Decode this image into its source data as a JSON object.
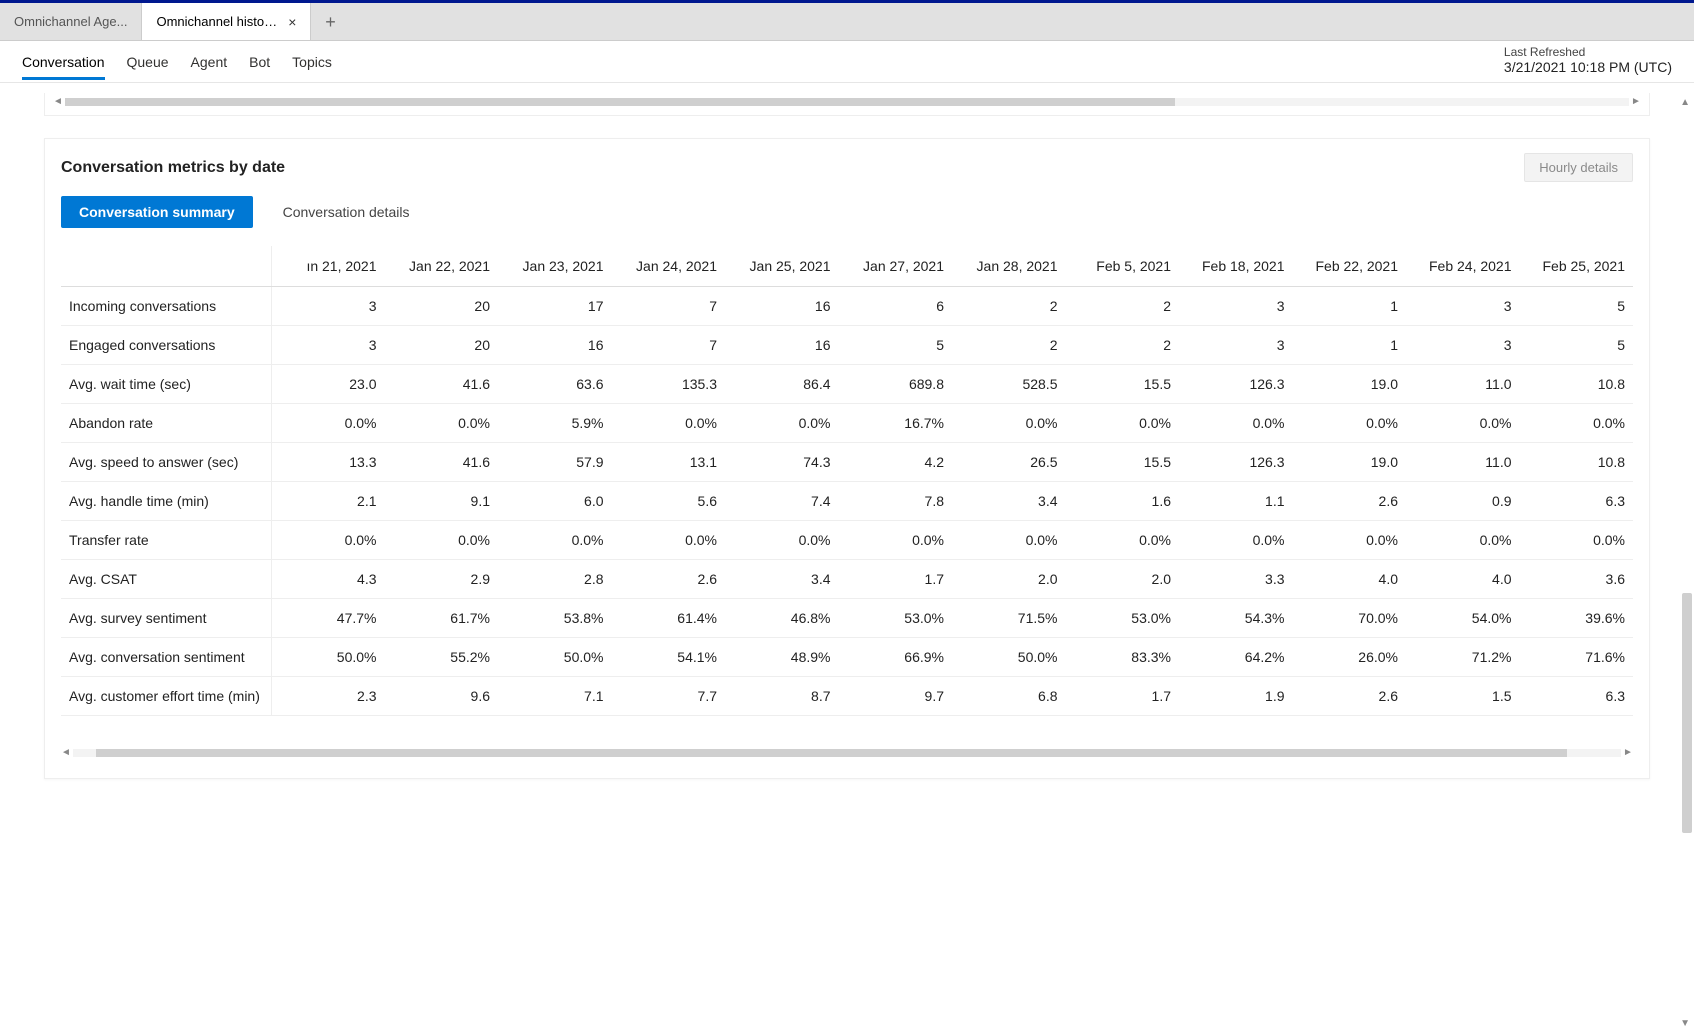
{
  "tabs": {
    "items": [
      {
        "label": "Omnichannel Age..."
      },
      {
        "label": "Omnichannel historical an..."
      }
    ],
    "activeIndex": 1
  },
  "nav": {
    "items": [
      "Conversation",
      "Queue",
      "Agent",
      "Bot",
      "Topics"
    ],
    "activeIndex": 0
  },
  "refresh": {
    "label": "Last Refreshed",
    "value": "3/21/2021 10:18 PM (UTC)"
  },
  "card": {
    "title": "Conversation metrics by date",
    "hourly_label": "Hourly details",
    "pills": [
      "Conversation summary",
      "Conversation details"
    ],
    "pillActive": 0
  },
  "chart_data": {
    "type": "table",
    "columns": [
      "ın 21, 2021",
      "Jan 22, 2021",
      "Jan 23, 2021",
      "Jan 24, 2021",
      "Jan 25, 2021",
      "Jan 27, 2021",
      "Jan 28, 2021",
      "Feb 5, 2021",
      "Feb 18, 2021",
      "Feb 22, 2021",
      "Feb 24, 2021",
      "Feb 25, 2021"
    ],
    "rows": [
      {
        "metric": "Incoming conversations",
        "values": [
          "3",
          "20",
          "17",
          "7",
          "16",
          "6",
          "2",
          "2",
          "3",
          "1",
          "3",
          "5"
        ]
      },
      {
        "metric": "Engaged conversations",
        "values": [
          "3",
          "20",
          "16",
          "7",
          "16",
          "5",
          "2",
          "2",
          "3",
          "1",
          "3",
          "5"
        ]
      },
      {
        "metric": "Avg. wait time (sec)",
        "values": [
          "23.0",
          "41.6",
          "63.6",
          "135.3",
          "86.4",
          "689.8",
          "528.5",
          "15.5",
          "126.3",
          "19.0",
          "11.0",
          "10.8"
        ]
      },
      {
        "metric": "Abandon rate",
        "values": [
          "0.0%",
          "0.0%",
          "5.9%",
          "0.0%",
          "0.0%",
          "16.7%",
          "0.0%",
          "0.0%",
          "0.0%",
          "0.0%",
          "0.0%",
          "0.0%"
        ]
      },
      {
        "metric": "Avg. speed to answer (sec)",
        "values": [
          "13.3",
          "41.6",
          "57.9",
          "13.1",
          "74.3",
          "4.2",
          "26.5",
          "15.5",
          "126.3",
          "19.0",
          "11.0",
          "10.8"
        ]
      },
      {
        "metric": "Avg. handle time (min)",
        "values": [
          "2.1",
          "9.1",
          "6.0",
          "5.6",
          "7.4",
          "7.8",
          "3.4",
          "1.6",
          "1.1",
          "2.6",
          "0.9",
          "6.3"
        ]
      },
      {
        "metric": "Transfer rate",
        "values": [
          "0.0%",
          "0.0%",
          "0.0%",
          "0.0%",
          "0.0%",
          "0.0%",
          "0.0%",
          "0.0%",
          "0.0%",
          "0.0%",
          "0.0%",
          "0.0%"
        ]
      },
      {
        "metric": "Avg. CSAT",
        "values": [
          "4.3",
          "2.9",
          "2.8",
          "2.6",
          "3.4",
          "1.7",
          "2.0",
          "2.0",
          "3.3",
          "4.0",
          "4.0",
          "3.6"
        ]
      },
      {
        "metric": "Avg. survey sentiment",
        "values": [
          "47.7%",
          "61.7%",
          "53.8%",
          "61.4%",
          "46.8%",
          "53.0%",
          "71.5%",
          "53.0%",
          "54.3%",
          "70.0%",
          "54.0%",
          "39.6%"
        ]
      },
      {
        "metric": "Avg. conversation sentiment",
        "values": [
          "50.0%",
          "55.2%",
          "50.0%",
          "54.1%",
          "48.9%",
          "66.9%",
          "50.0%",
          "83.3%",
          "64.2%",
          "26.0%",
          "71.2%",
          "71.6%"
        ]
      },
      {
        "metric": "Avg. customer effort time (min)",
        "values": [
          "2.3",
          "9.6",
          "7.1",
          "7.7",
          "8.7",
          "9.7",
          "6.8",
          "1.7",
          "1.9",
          "2.6",
          "1.5",
          "6.3"
        ]
      }
    ]
  }
}
